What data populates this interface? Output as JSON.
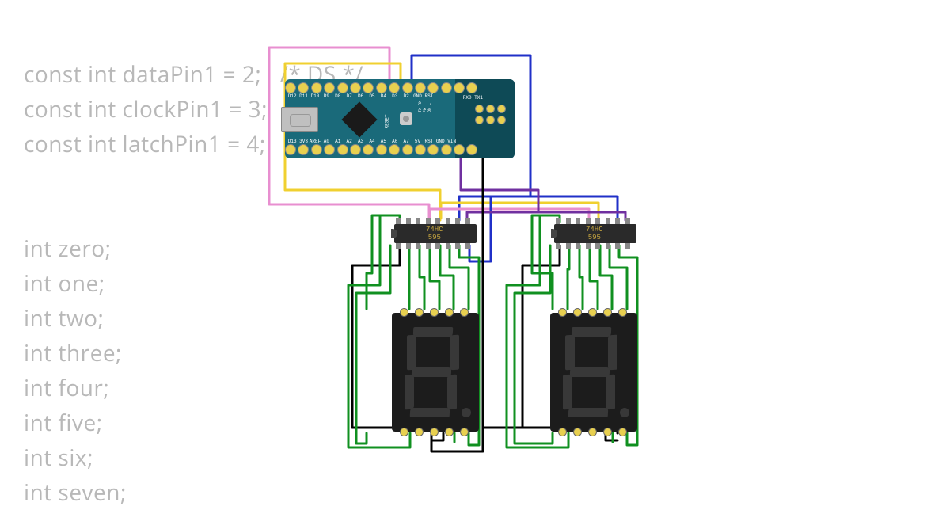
{
  "code": {
    "line1": "const int dataPin1 = 2;   /* DS */",
    "line2": "const int clockPin1 = 3;   /* ",
    "line3": "const int latchPin1 = 4;   /",
    "blank": "",
    "line5": "int zero;",
    "line6": "int one;",
    "line7": "int two;",
    "line8": "int three;",
    "line9": "int four;",
    "line10": "int five;",
    "line11": "int six;",
    "line12": "int seven;"
  },
  "arduino": {
    "name": "Arduino Nano",
    "top_pins": [
      "D12",
      "D11",
      "D10",
      "D9",
      "D8",
      "D7",
      "D6",
      "D5",
      "D4",
      "D3",
      "D2",
      "GND",
      "RST"
    ],
    "bot_pins": [
      "D13",
      "3V3",
      "AREF",
      "A0",
      "A1",
      "A2",
      "A3",
      "A4",
      "A5",
      "A6",
      "A7",
      "5V",
      "RST",
      "GND",
      "VIN"
    ],
    "rxtx": "RX0 TX1",
    "reset": "RESET",
    "sidelabels": "TX RX\nPW\nON L"
  },
  "chip595": {
    "line1": "74HC",
    "line2": "595"
  },
  "wire_colors": {
    "pink": "#e88fd0",
    "yellow": "#f0d030",
    "blue": "#2030c8",
    "purple": "#7030a0",
    "black": "#000000",
    "green": "#109020"
  },
  "components": [
    "Arduino Nano",
    "74HC595 shift register x2",
    "7-segment display x2"
  ]
}
